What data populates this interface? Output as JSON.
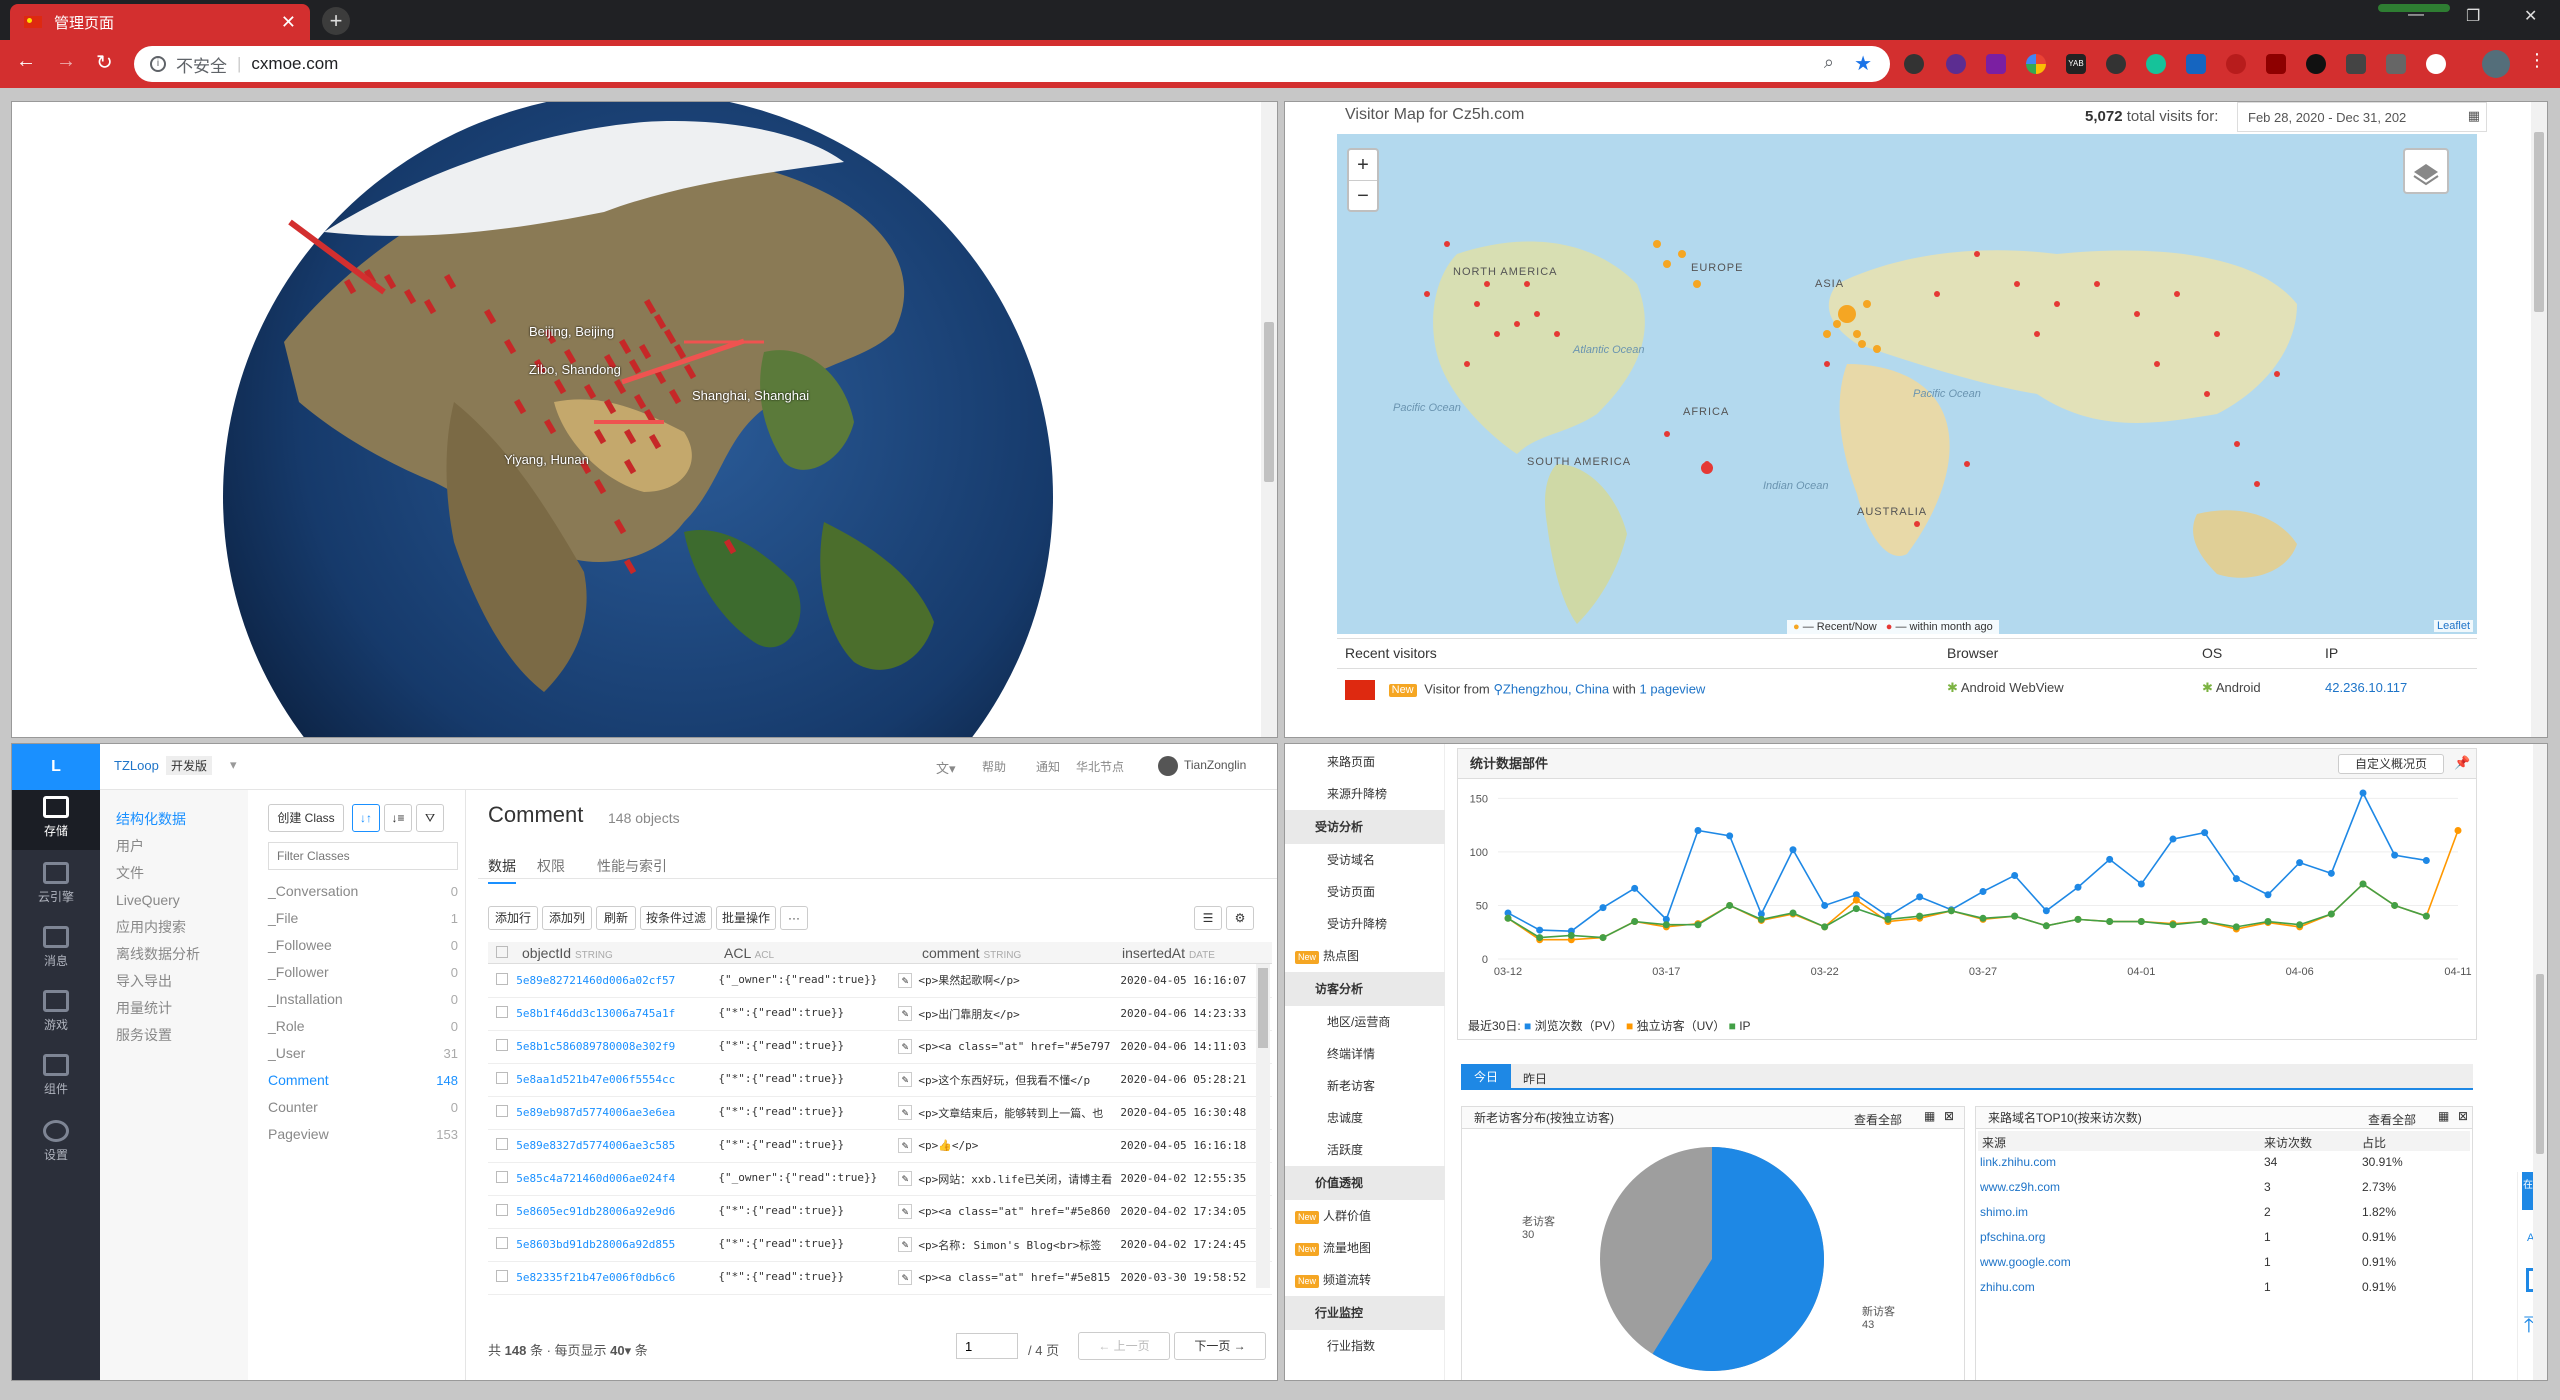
{
  "browser": {
    "tab_title": "管理页面",
    "insecure": "不安全",
    "url": "cxmoe.com"
  },
  "globe": {
    "cities": [
      {
        "name": "Beijing, Beijing"
      },
      {
        "name": "Zibo, Shandong"
      },
      {
        "name": "Shanghai, Shanghai"
      },
      {
        "name": "Yiyang, Hunan"
      }
    ]
  },
  "map": {
    "title": "Visitor Map for Cz5h.com",
    "total_visits": "5,072",
    "total_suffix": "total visits for:",
    "date_range": "Feb 28, 2020 - Dec 31, 202",
    "continents": [
      "NORTH AMERICA",
      "EUROPE",
      "ASIA",
      "AFRICA",
      "SOUTH AMERICA",
      "AUSTRALIA"
    ],
    "oceans": [
      "Atlantic Ocean",
      "Pacific Ocean",
      "Pacific Ocean",
      "Indian Ocean"
    ],
    "legend_recent": "— Recent/Now",
    "legend_month": "— within month ago",
    "attribution": "Leaflet",
    "recent_header": "Recent visitors",
    "col_browser": "Browser",
    "col_os": "OS",
    "col_ip": "IP",
    "visitor": {
      "badge": "New",
      "prefix": "Visitor from",
      "location": "Zhengzhou, China",
      "with": "with",
      "pageviews": "1 pageview",
      "browser": "Android WebView",
      "os": "Android",
      "ip": "42.236.10.117"
    }
  },
  "lc": {
    "logo": "L",
    "app": "TZLoop",
    "env": "开发版",
    "top_right": [
      "帮助",
      "通知",
      "华北节点",
      "TianZonglin"
    ],
    "side": [
      "存储",
      "云引擎",
      "消息",
      "游戏",
      "组件",
      "设置"
    ],
    "nav": [
      "结构化数据",
      "用户",
      "文件",
      "LiveQuery",
      "应用内搜索",
      "离线数据分析",
      "导入导出",
      "用量统计",
      "服务设置"
    ],
    "create_class": "创建 Class",
    "filter_placeholder": "Filter Classes",
    "classes": [
      {
        "name": "_Conversation",
        "n": "0"
      },
      {
        "name": "_File",
        "n": "1"
      },
      {
        "name": "_Followee",
        "n": "0"
      },
      {
        "name": "_Follower",
        "n": "0"
      },
      {
        "name": "_Installation",
        "n": "0"
      },
      {
        "name": "_Role",
        "n": "0"
      },
      {
        "name": "_User",
        "n": "31"
      },
      {
        "name": "Comment",
        "n": "148"
      },
      {
        "name": "Counter",
        "n": "0"
      },
      {
        "name": "Pageview",
        "n": "153"
      }
    ],
    "class_title": "Comment",
    "class_count": "148 objects",
    "tabs": [
      "数据",
      "权限",
      "性能与索引"
    ],
    "actions": [
      "添加行",
      "添加列",
      "刷新",
      "按条件过滤",
      "批量操作",
      "···"
    ],
    "columns": [
      {
        "name": "objectId",
        "type": "STRING"
      },
      {
        "name": "ACL",
        "type": "ACL"
      },
      {
        "name": "comment",
        "type": "STRING"
      },
      {
        "name": "insertedAt",
        "type": "DATE"
      }
    ],
    "rows": [
      [
        "5e89e82721460d006a02cf57",
        "{\"_owner\":{\"read\":true}}",
        "<p>果然起歌啊</p>",
        "2020-04-05 16:16:07"
      ],
      [
        "5e8b1f46dd3c13006a745a1f",
        "{\"*\":{\"read\":true}}",
        "<p>出门靠朋友</p>",
        "2020-04-06 14:23:33"
      ],
      [
        "5e8b1c586089780008e302f9",
        "{\"*\":{\"read\":true}}",
        "<p><a class=\"at\" href=\"#5e797",
        "2020-04-06 14:11:03"
      ],
      [
        "5e8aa1d521b47e006f5554cc",
        "{\"*\":{\"read\":true}}",
        "<p>这个东西好玩，但我看不懂</p",
        "2020-04-06 05:28:21"
      ],
      [
        "5e89eb987d5774006ae3e6ea",
        "{\"*\":{\"read\":true}}",
        "<p>文章结束后，能够转到上一篇、也",
        "2020-04-05 16:30:48"
      ],
      [
        "5e89e8327d5774006ae3c585",
        "{\"*\":{\"read\":true}}",
        "<p>👍</p>",
        "2020-04-05 16:16:18"
      ],
      [
        "5e85c4a721460d006ae024f4",
        "{\"_owner\":{\"read\":true}}",
        "<p>网站：xxb.life已关闭，请博主看",
        "2020-04-02 12:55:35"
      ],
      [
        "5e8605ec91db28006a92e9d6",
        "{\"*\":{\"read\":true}}",
        "<p><a class=\"at\" href=\"#5e860",
        "2020-04-02 17:34:05"
      ],
      [
        "5e8603bd91db28006a92d855",
        "{\"*\":{\"read\":true}}",
        "<p>名称:  Simon's Blog<br>标签",
        "2020-04-02 17:24:45"
      ],
      [
        "5e82335f21b47e006f0db6c6",
        "{\"*\":{\"read\":true}}",
        "<p><a class=\"at\" href=\"#5e815",
        "2020-03-30 19:58:52"
      ]
    ],
    "footer_total_a": "共",
    "footer_total": "148",
    "footer_total_b": "条 · 每页显示",
    "footer_per": "40",
    "footer_per_b": "条",
    "page_input": "1",
    "page_total": "/ 4 页",
    "prev": "上一页",
    "next": "下一页"
  },
  "stats": {
    "side_items": [
      {
        "t": "来路页面",
        "k": "it"
      },
      {
        "t": "来源升降榜",
        "k": "it"
      },
      {
        "t": "受访分析",
        "k": "grp"
      },
      {
        "t": "受访域名",
        "k": "it"
      },
      {
        "t": "受访页面",
        "k": "it"
      },
      {
        "t": "受访升降榜",
        "k": "it"
      },
      {
        "t": "热点图",
        "k": "new"
      },
      {
        "t": "访客分析",
        "k": "grp"
      },
      {
        "t": "地区/运营商",
        "k": "it"
      },
      {
        "t": "终端详情",
        "k": "it"
      },
      {
        "t": "新老访客",
        "k": "it"
      },
      {
        "t": "忠诚度",
        "k": "it"
      },
      {
        "t": "活跃度",
        "k": "it"
      },
      {
        "t": "价值透视",
        "k": "grp"
      },
      {
        "t": "人群价值",
        "k": "new"
      },
      {
        "t": "流量地图",
        "k": "new"
      },
      {
        "t": "频道流转",
        "k": "new"
      },
      {
        "t": "行业监控",
        "k": "grp"
      },
      {
        "t": "行业指数",
        "k": "it"
      }
    ],
    "card_title": "统计数据部件",
    "custom_btn": "自定义概况页",
    "chart_legend_prefix": "最近30日:",
    "legend": [
      "浏览次数（PV）",
      "独立访客（UV）",
      "IP"
    ],
    "day_tabs": [
      "今日",
      "昨日"
    ],
    "newold_title": "新老访客分布(按独立访客)",
    "view_all": "查看全部",
    "pie": {
      "old_label": "老访客",
      "old_value": "30",
      "new_label": "新访客",
      "new_value": "43"
    },
    "top_title": "来路域名TOP10(按来访次数)",
    "top_cols": [
      "来源",
      "来访次数",
      "占比"
    ],
    "top_rows": [
      [
        "link.zhihu.com",
        "34",
        "30.91%"
      ],
      [
        "www.cz9h.com",
        "3",
        "2.73%"
      ],
      [
        "shimo.im",
        "2",
        "1.82%"
      ],
      [
        "pfschina.org",
        "1",
        "0.91%"
      ],
      [
        "www.google.com",
        "1",
        "0.91%"
      ],
      [
        "zhihu.com",
        "1",
        "0.91%"
      ]
    ],
    "float": [
      "在线客服",
      "APP"
    ]
  },
  "chart_data": {
    "type": "line",
    "x": [
      "03-12",
      "03-13",
      "03-14",
      "03-15",
      "03-16",
      "03-17",
      "03-18",
      "03-19",
      "03-20",
      "03-21",
      "03-22",
      "03-23",
      "03-24",
      "03-25",
      "03-26",
      "03-27",
      "03-28",
      "03-29",
      "03-30",
      "03-31",
      "04-01",
      "04-02",
      "04-03",
      "04-04",
      "04-05",
      "04-06",
      "04-07",
      "04-08",
      "04-09",
      "04-10",
      "04-11"
    ],
    "xticks": [
      "03-12",
      "03-17",
      "03-22",
      "03-27",
      "04-01",
      "04-06",
      "04-11"
    ],
    "yticks": [
      "0",
      "50",
      "100",
      "150"
    ],
    "ylim": [
      0,
      155
    ],
    "series": [
      {
        "name": "浏览次数（PV）",
        "color": "#1e88e5",
        "values": [
          43,
          27,
          26,
          48,
          66,
          37,
          120,
          115,
          42,
          102,
          50,
          60,
          40,
          58,
          46,
          63,
          78,
          45,
          67,
          93,
          70,
          112,
          118,
          75,
          60,
          90,
          80,
          155,
          97,
          92,
          null
        ]
      },
      {
        "name": "独立访客（UV）",
        "color": "#ff9800",
        "values": [
          38,
          18,
          18,
          20,
          35,
          30,
          33,
          50,
          36,
          42,
          30,
          55,
          35,
          38,
          45,
          37,
          40,
          31,
          37,
          35,
          35,
          33,
          35,
          28,
          34,
          30,
          42,
          70,
          50,
          40,
          120
        ]
      },
      {
        "name": "IP",
        "color": "#43a047",
        "values": [
          38,
          20,
          22,
          20,
          35,
          32,
          32,
          50,
          37,
          43,
          30,
          47,
          37,
          40,
          45,
          38,
          40,
          31,
          37,
          35,
          35,
          32,
          35,
          30,
          35,
          32,
          42,
          70,
          50,
          40,
          null
        ]
      }
    ]
  }
}
